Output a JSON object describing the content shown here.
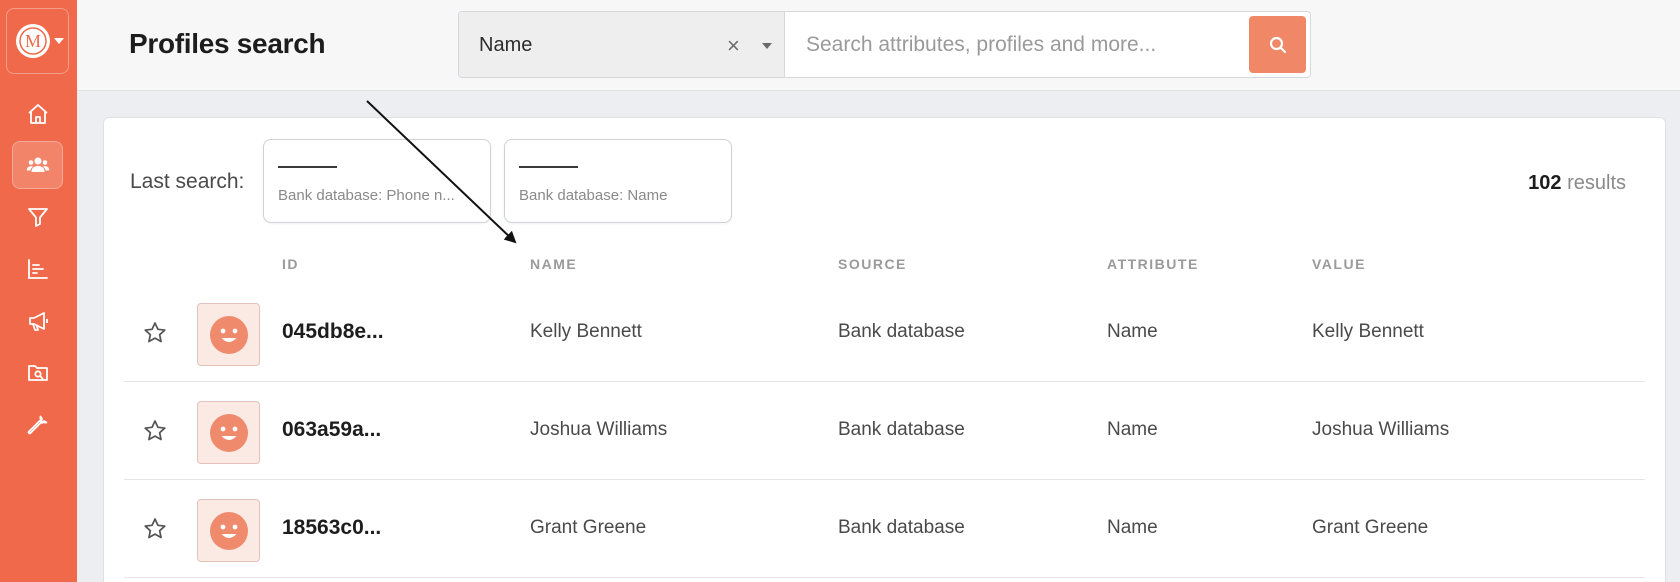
{
  "app": {
    "logo_letter": "M",
    "accent_color": "#f0694a"
  },
  "sidebar": {
    "items": [
      {
        "name": "home",
        "icon": "home-icon",
        "active": false
      },
      {
        "name": "profiles",
        "icon": "users-icon",
        "active": true
      },
      {
        "name": "filters",
        "icon": "filter-icon",
        "active": false
      },
      {
        "name": "analytics",
        "icon": "bar-chart-icon",
        "active": false
      },
      {
        "name": "campaigns",
        "icon": "megaphone-icon",
        "active": false
      },
      {
        "name": "folder-search",
        "icon": "folder-search-icon",
        "active": false
      },
      {
        "name": "settings",
        "icon": "wrench-icon",
        "active": false
      }
    ]
  },
  "header": {
    "title": "Profiles search",
    "search": {
      "select_value": "Name",
      "clear_symbol": "×",
      "placeholder": "Search attributes, profiles and more..."
    }
  },
  "last_search": {
    "label": "Last search:",
    "chips": [
      {
        "label": "Bank database: Phone n..."
      },
      {
        "label": "Bank database: Name"
      }
    ]
  },
  "results": {
    "count": "102",
    "suffix": " results"
  },
  "table": {
    "columns": [
      "ID",
      "NAME",
      "SOURCE",
      "ATTRIBUTE",
      "VALUE"
    ],
    "rows": [
      {
        "id": "045db8e...",
        "name": "Kelly Bennett",
        "source": "Bank database",
        "attribute": "Name",
        "value": "Kelly Bennett"
      },
      {
        "id": "063a59a...",
        "name": "Joshua Williams",
        "source": "Bank database",
        "attribute": "Name",
        "value": "Joshua Williams"
      },
      {
        "id": "18563c0...",
        "name": "Grant Greene",
        "source": "Bank database",
        "attribute": "Name",
        "value": "Grant Greene"
      }
    ]
  }
}
